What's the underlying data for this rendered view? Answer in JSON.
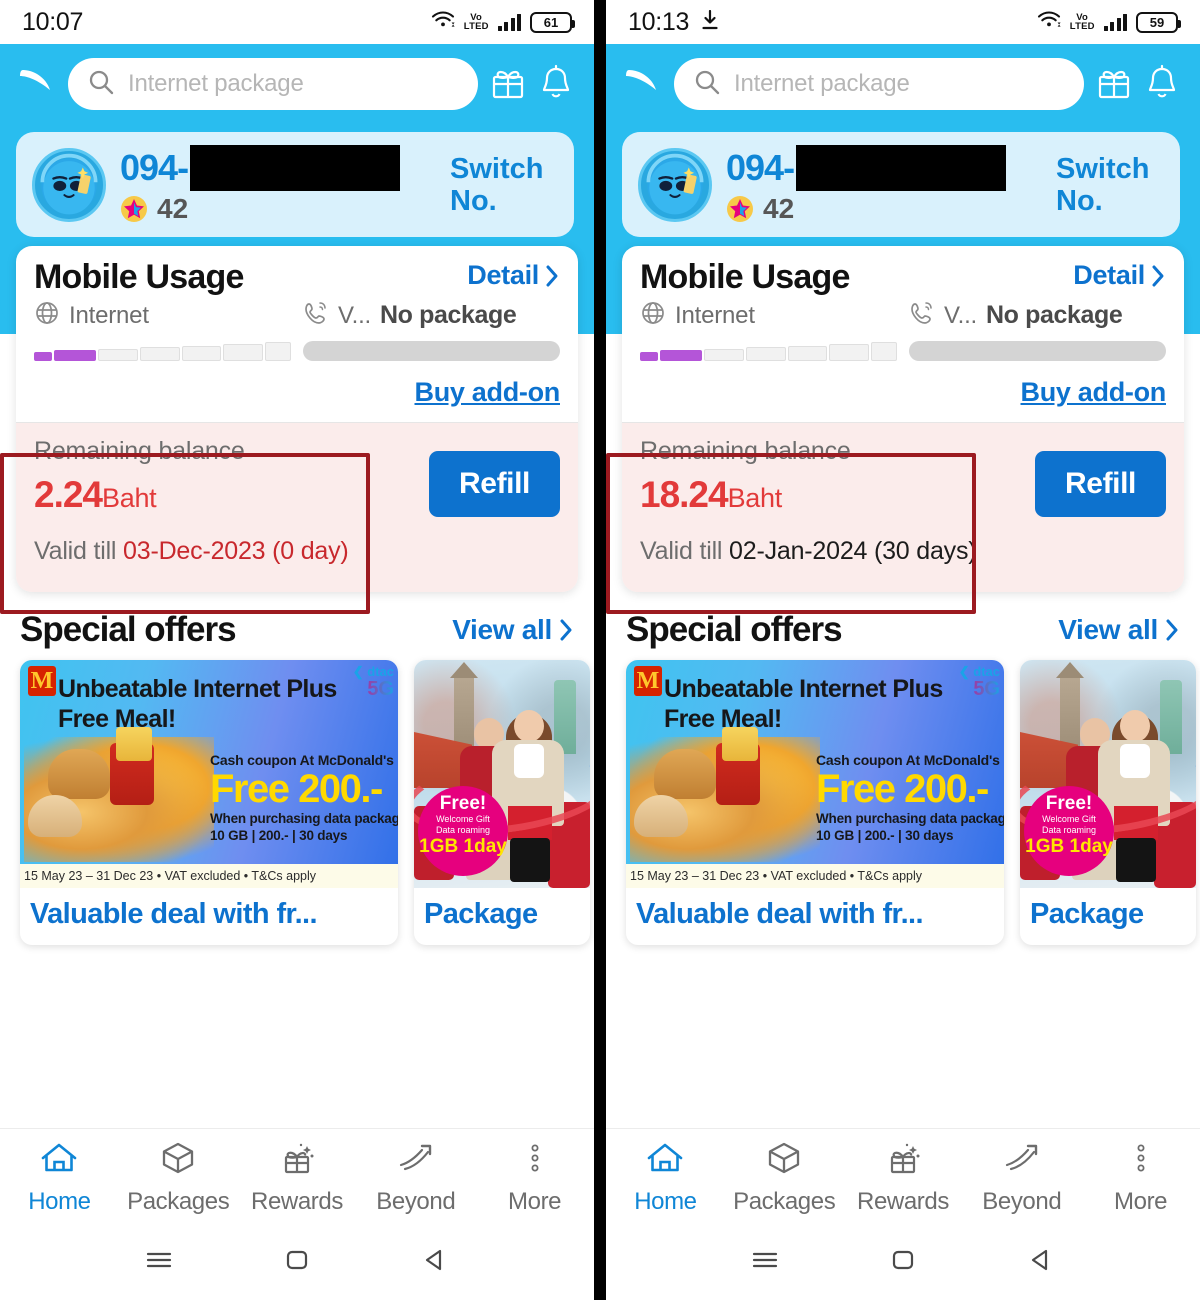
{
  "panels": [
    {
      "id": "left",
      "statusbar": {
        "time": "10:07",
        "battery": "61",
        "network": "VoLTE",
        "download_icon": false
      },
      "header": {
        "logo": "dtac-logo",
        "search_placeholder": "Internet package",
        "gift_icon": "gift-icon",
        "bell_icon": "bell-icon"
      },
      "profile": {
        "number_prefix": "094-",
        "points": "42",
        "switch_label": "Switch No."
      },
      "usage": {
        "title": "Mobile Usage",
        "detail_label": "Detail",
        "internet_label": "Internet",
        "voice_label": "V...",
        "voice_value": "No package",
        "addon_label": "Buy add-on",
        "internet_segments": 7,
        "internet_filled": 2
      },
      "balance": {
        "label": "Remaining balance",
        "amount": "2.24",
        "currency": "Baht",
        "valid_prefix": "Valid till ",
        "valid_value": "03-Dec-2023 (0 day)",
        "valid_value_color": "#c8282d",
        "refill_label": "Refill",
        "highlighted": true
      },
      "special_offers": {
        "title": "Special offers",
        "view_all": "View all",
        "cards": [
          {
            "type": "mcdonalds",
            "logo": "M",
            "title": "Unbeatable Internet Plus Free Meal!",
            "brand": "dtac",
            "brand_5g": "5G",
            "sub1": "Cash coupon At McDonald's",
            "sub2": "Free 200.-",
            "sub3": "When purchasing data package",
            "sub4": "10 GB | 200.- | 30 days",
            "footnote": "15 May 23 – 31 Dec 23 • VAT excluded • T&Cs apply",
            "caption": "Valuable deal with fr..."
          },
          {
            "type": "roaming",
            "badge_free": "Free!",
            "badge_line1": "Welcome Gift",
            "badge_line2": "Data roaming",
            "badge_big": "1GB 1day",
            "caption": "Package"
          }
        ]
      },
      "tabs": [
        {
          "label": "Home",
          "icon": "home-icon",
          "active": true
        },
        {
          "label": "Packages",
          "icon": "cube-icon",
          "active": false
        },
        {
          "label": "Rewards",
          "icon": "gift-sparkle-icon",
          "active": false
        },
        {
          "label": "Beyond",
          "icon": "arrow-swoosh-icon",
          "active": false
        },
        {
          "label": "More",
          "icon": "more-dots-icon",
          "active": false
        }
      ],
      "sysnav": [
        "menu-icon",
        "home-square-icon",
        "back-triangle-icon"
      ]
    },
    {
      "id": "right",
      "statusbar": {
        "time": "10:13",
        "battery": "59",
        "network": "VoLTE",
        "download_icon": true
      },
      "header": {
        "logo": "dtac-logo",
        "search_placeholder": "Internet package",
        "gift_icon": "gift-icon",
        "bell_icon": "bell-icon"
      },
      "profile": {
        "number_prefix": "094-",
        "points": "42",
        "switch_label": "Switch No."
      },
      "usage": {
        "title": "Mobile Usage",
        "detail_label": "Detail",
        "internet_label": "Internet",
        "voice_label": "V...",
        "voice_value": "No package",
        "addon_label": "Buy add-on",
        "internet_segments": 7,
        "internet_filled": 2
      },
      "balance": {
        "label": "Remaining balance",
        "amount": "18.24",
        "currency": "Baht",
        "valid_prefix": "Valid till ",
        "valid_value": "02-Jan-2024 (30 days)",
        "valid_value_color": "#1c1c1c",
        "refill_label": "Refill",
        "highlighted": true
      },
      "special_offers": {
        "title": "Special offers",
        "view_all": "View all",
        "cards": [
          {
            "type": "mcdonalds",
            "logo": "M",
            "title": "Unbeatable Internet Plus Free Meal!",
            "brand": "dtac",
            "brand_5g": "5G",
            "sub1": "Cash coupon At McDonald's",
            "sub2": "Free 200.-",
            "sub3": "When purchasing data package",
            "sub4": "10 GB | 200.- | 30 days",
            "footnote": "15 May 23 – 31 Dec 23 • VAT excluded • T&Cs apply",
            "caption": "Valuable deal with fr..."
          },
          {
            "type": "roaming",
            "badge_free": "Free!",
            "badge_line1": "Welcome Gift",
            "badge_line2": "Data roaming",
            "badge_big": "1GB 1day",
            "caption": "Package"
          }
        ]
      },
      "tabs": [
        {
          "label": "Home",
          "icon": "home-icon",
          "active": true
        },
        {
          "label": "Packages",
          "icon": "cube-icon",
          "active": false
        },
        {
          "label": "Rewards",
          "icon": "gift-sparkle-icon",
          "active": false
        },
        {
          "label": "Beyond",
          "icon": "arrow-swoosh-icon",
          "active": false
        },
        {
          "label": "More",
          "icon": "more-dots-icon",
          "active": false
        }
      ],
      "sysnav": [
        "menu-icon",
        "home-square-icon",
        "back-triangle-icon"
      ]
    }
  ],
  "colors": {
    "header_blue": "#29bdef",
    "link_blue": "#0d72ce",
    "brand_blue": "#0f86d6",
    "balance_red": "#e23a3a",
    "highlight_red": "#9c1a20",
    "balance_bg": "#fbeceb",
    "progress_purple": "#b455d8"
  }
}
